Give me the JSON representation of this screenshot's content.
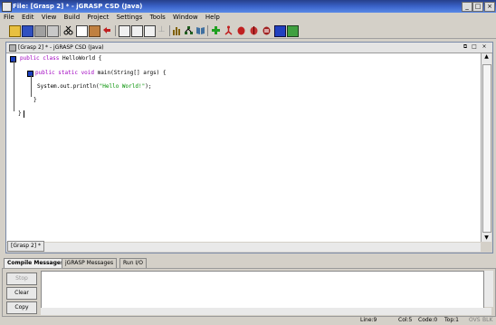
{
  "window": {
    "title": "File: [Grasp 2] * - jGRASP CSD (Java)",
    "minimize": "_",
    "maximize": "□",
    "close": "×"
  },
  "menubar": {
    "items": [
      "File",
      "Edit",
      "View",
      "Build",
      "Project",
      "Settings",
      "Tools",
      "Window",
      "Help"
    ]
  },
  "toolbar": {
    "icons": [
      "open-folder-icon",
      "save-icon",
      "save-all-icon",
      "print-icon",
      "cut-icon",
      "copy-icon",
      "paste-icon",
      "undo-icon",
      "generate-csd-icon",
      "remove-csd-icon",
      "doc-icon",
      "fold-icon",
      "unfold-icon",
      "bar-chart-icon",
      "tree-icon",
      "book-icon",
      "compile-icon",
      "run-icon",
      "debug-icon",
      "step-icon",
      "stop-icon",
      "uml-icon",
      "window-icon"
    ]
  },
  "editor": {
    "frame_title": "[Grasp 2] * - jGRASP CSD (Java)",
    "code_lines": [
      {
        "kw": "public class",
        "text": " HelloWorld {"
      },
      {
        "kw": "public static void",
        "text": " main(String[] args) {"
      },
      {
        "pre": "System.out.println(",
        "str": "\"Hello World!\"",
        "post": ");"
      },
      {
        "text": "}"
      },
      {
        "text": "}"
      }
    ],
    "doc_tab": "[Grasp 2] *"
  },
  "messages": {
    "tabs": [
      "Compile Messages",
      "jGRASP Messages",
      "Run I/O"
    ],
    "active_tab": "Compile Messages",
    "buttons": {
      "stop": "Stop",
      "clear": "Clear",
      "copy": "Copy"
    }
  },
  "status": {
    "line": "Line:9",
    "col": "Col:5",
    "code": "Code:0",
    "top": "Top:1",
    "mode": "OVS",
    "blk": "BLK"
  },
  "colors": {
    "keyword": "#a000c0",
    "string": "#009000",
    "titlebar": "#3a62c8"
  }
}
